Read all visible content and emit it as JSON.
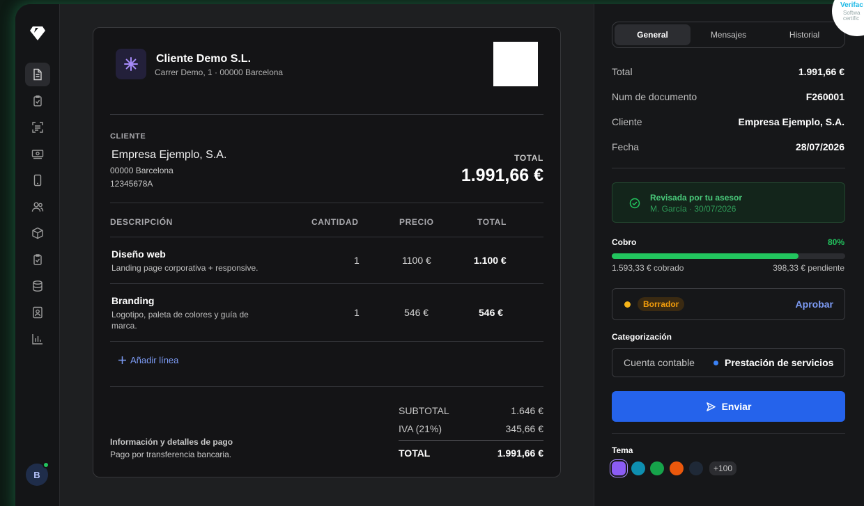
{
  "company": {
    "name": "Cliente Demo S.L.",
    "address": "Carrer Demo, 1 · 00000 Barcelona"
  },
  "client": {
    "label": "CLIENTE",
    "name": "Empresa Ejemplo, S.A.",
    "city": "00000 Barcelona",
    "tax_id": "12345678A"
  },
  "invoice_total": {
    "label": "TOTAL",
    "value": "1.991,66 €"
  },
  "table": {
    "headers": [
      "DESCRIPCIÓN",
      "CANTIDAD",
      "PRECIO",
      "TOTAL"
    ],
    "rows": [
      {
        "title": "Diseño web",
        "desc": "Landing page corporativa + responsive.",
        "qty": "1",
        "price": "1100 €",
        "total": "1.100 €"
      },
      {
        "title": "Branding",
        "desc": "Logotipo, paleta de colores y guía de marca.",
        "qty": "1",
        "price": "546 €",
        "total": "546 €"
      }
    ],
    "add_line": "Añadir línea"
  },
  "payment": {
    "title": "Información y detalles de pago",
    "text": "Pago por transferencia bancaria."
  },
  "summary": {
    "subtotal_label": "SUBTOTAL",
    "subtotal": "1.646 €",
    "iva_label": "IVA (21%)",
    "iva": "345,66 €",
    "total_label": "TOTAL",
    "total": "1.991,66 €"
  },
  "panel": {
    "tabs": [
      "General",
      "Mensajes",
      "Historial"
    ],
    "details": [
      {
        "label": "Total",
        "value": "1.991,66 €"
      },
      {
        "label": "Num de documento",
        "value": "F260001"
      },
      {
        "label": "Cliente",
        "value": "Empresa Ejemplo, S.A."
      },
      {
        "label": "Fecha",
        "value": "28/07/2026"
      }
    ],
    "review": {
      "title": "Revisada por tu asesor",
      "subtitle": "M. García · 30/07/2026"
    },
    "cobro": {
      "label": "Cobro",
      "percent_text": "80%",
      "progress": 0.8,
      "collected": "1.593,33 € cobrado",
      "pending": "398,33 € pendiente"
    },
    "status": {
      "badge": "Borrador",
      "action": "Aprobar"
    },
    "category": {
      "label": "Categorización",
      "key": "Cuenta contable",
      "value": "Prestación de servicios"
    },
    "send_label": "Enviar",
    "theme": {
      "label": "Tema",
      "swatches": [
        "#8b5cf6",
        "#0e8fb0",
        "#16a34a",
        "#ea580c",
        "#1f2937"
      ],
      "more": "+100"
    }
  },
  "user": {
    "initial": "B"
  },
  "verify_badge": {
    "title": "Verifac",
    "line1": "Softwa",
    "line2": "certific"
  },
  "colors": {
    "accent": "#2563eb",
    "success": "#22c55e",
    "warning": "#f59e0b",
    "link": "#7d9cf6"
  }
}
